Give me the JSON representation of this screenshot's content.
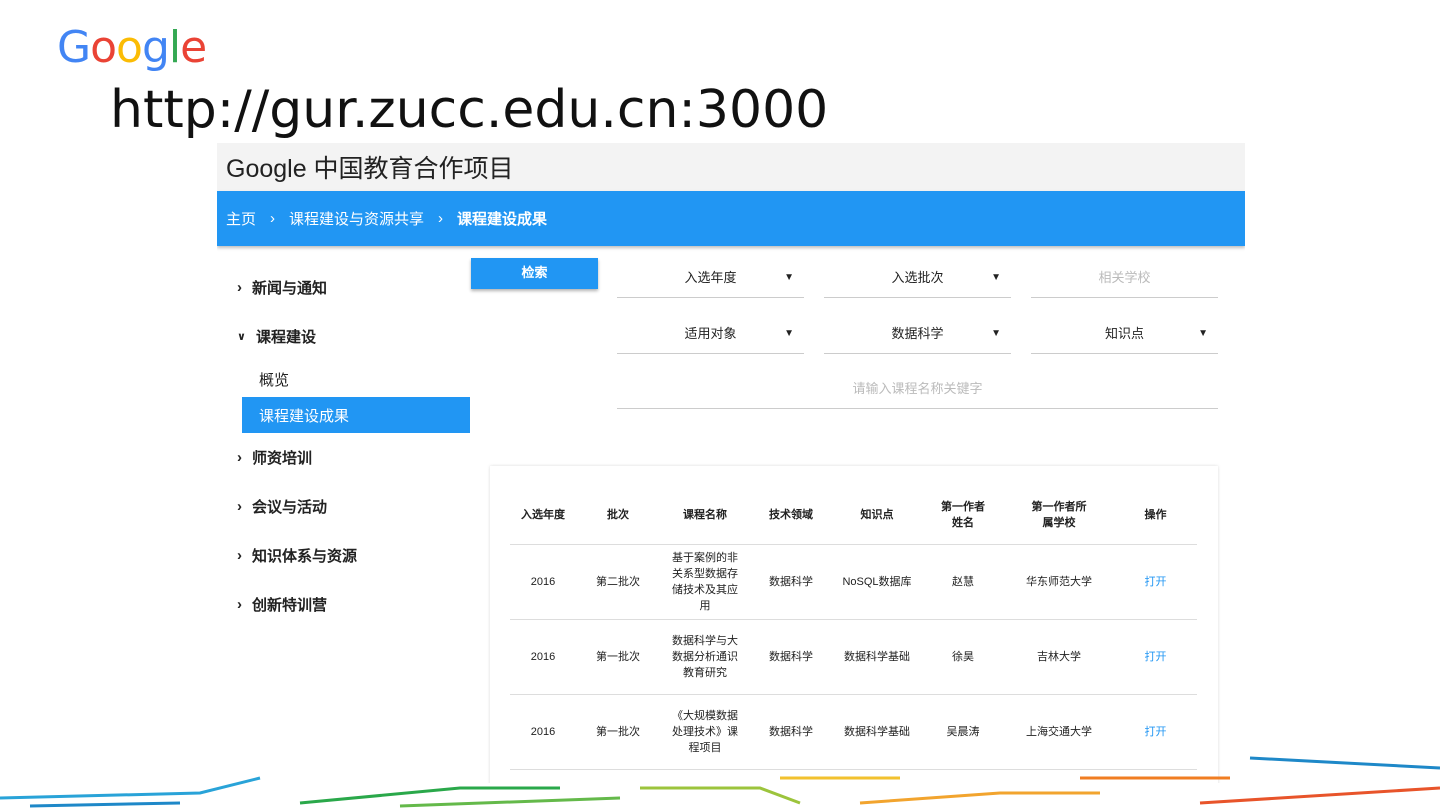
{
  "slide": {
    "logo": "Google",
    "url": "http://gur.zucc.edu.cn:3000"
  },
  "app": {
    "title": "Google 中国教育合作项目"
  },
  "breadcrumb": [
    "主页",
    "课程建设与资源共享",
    "课程建设成果"
  ],
  "sidebar": {
    "items": [
      {
        "label": "新闻与通知",
        "expanded": false
      },
      {
        "label": "课程建设",
        "expanded": true,
        "children": [
          {
            "label": "概览"
          },
          {
            "label": "课程建设成果",
            "active": true
          }
        ]
      },
      {
        "label": "师资培训",
        "expanded": false
      },
      {
        "label": "会议与活动",
        "expanded": false
      },
      {
        "label": "知识体系与资源",
        "expanded": false
      },
      {
        "label": "创新特训营",
        "expanded": false
      }
    ]
  },
  "search": {
    "button": "检索",
    "filters": [
      "入选年度",
      "入选批次",
      "相关学校",
      "适用对象",
      "数据科学",
      "知识点"
    ],
    "keyword_placeholder": "请输入课程名称关键字"
  },
  "table": {
    "headers": [
      "入选年度",
      "批次",
      "课程名称",
      "技术领域",
      "知识点",
      "第一作者姓名",
      "第一作者所属学校",
      "操作"
    ],
    "rows": [
      [
        "2016",
        "第二批次",
        "基于案例的非关系型数据存储技术及其应用",
        "数据科学",
        "NoSQL数据库",
        "赵慧",
        "华东师范大学",
        "打开"
      ],
      [
        "2016",
        "第一批次",
        "数据科学与大数据分析通识教育研究",
        "数据科学",
        "数据科学基础",
        "徐昊",
        "吉林大学",
        "打开"
      ],
      [
        "2016",
        "第一批次",
        "《大规模数据处理技术》课程项目",
        "数据科学",
        "数据科学基础",
        "吴晨涛",
        "上海交通大学",
        "打开"
      ]
    ]
  },
  "colors": {
    "accent": "#2196f3"
  }
}
